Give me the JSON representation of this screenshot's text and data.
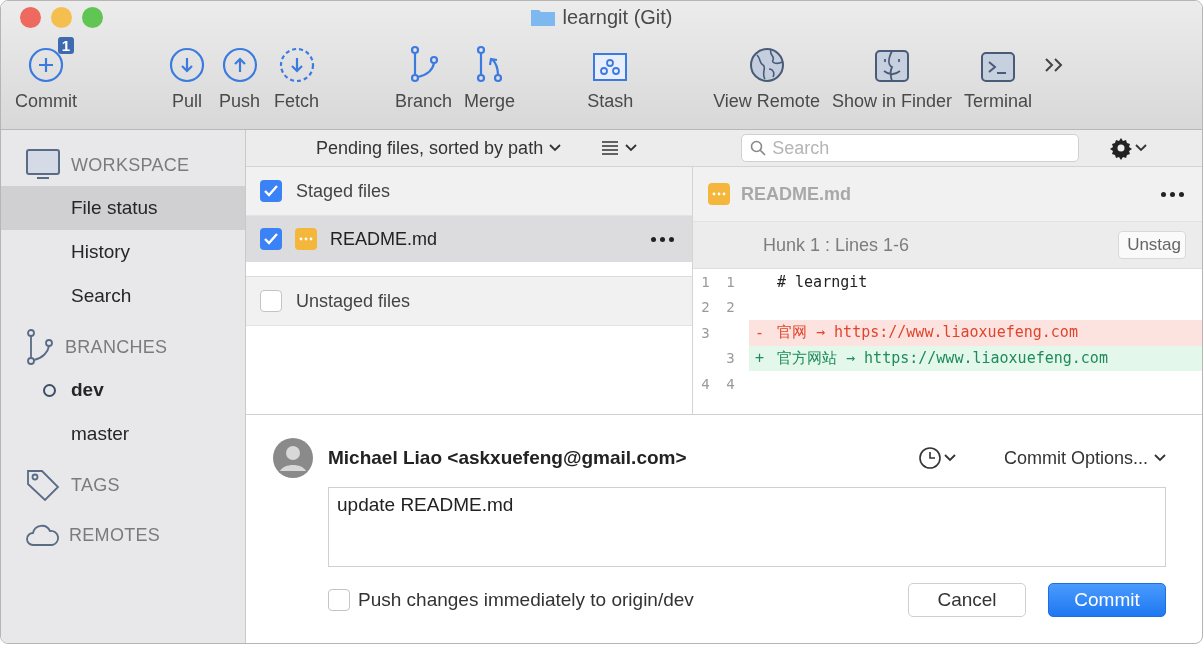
{
  "window": {
    "title": "learngit (Git)"
  },
  "toolbar": {
    "buttons": [
      {
        "label": "Commit",
        "badge": "1"
      },
      {
        "label": "Pull"
      },
      {
        "label": "Push"
      },
      {
        "label": "Fetch"
      },
      {
        "label": "Branch"
      },
      {
        "label": "Merge"
      },
      {
        "label": "Stash"
      },
      {
        "label": "View Remote"
      },
      {
        "label": "Show in Finder"
      },
      {
        "label": "Terminal"
      }
    ]
  },
  "sidebar": {
    "sections": [
      {
        "heading": "WORKSPACE",
        "items": [
          {
            "label": "File status",
            "selected": true,
            "current": false
          },
          {
            "label": "History",
            "selected": false,
            "current": false
          },
          {
            "label": "Search",
            "selected": false,
            "current": false
          }
        ]
      },
      {
        "heading": "BRANCHES",
        "items": [
          {
            "label": "dev",
            "selected": false,
            "current": true
          },
          {
            "label": "master",
            "selected": false,
            "current": false
          }
        ]
      },
      {
        "heading": "TAGS"
      },
      {
        "heading": "REMOTES"
      }
    ]
  },
  "filter_bar": {
    "sort_label": "Pending files, sorted by path",
    "search": {
      "placeholder": "Search"
    }
  },
  "staged": {
    "label": "Staged files",
    "checked": true,
    "files": [
      {
        "name": "README.md",
        "checked": true,
        "selected": true
      }
    ]
  },
  "unstaged": {
    "label": "Unstaged files",
    "checked": false
  },
  "diff": {
    "file": "README.md",
    "hunk_title": "Hunk 1 : Lines 1-6",
    "hunk_button": "Unstag",
    "lines": [
      {
        "kind": "context",
        "old": "1",
        "new": "1",
        "text": "# learngit"
      },
      {
        "kind": "context",
        "old": "2",
        "new": "2"
      },
      {
        "kind": "removed",
        "old": "3",
        "sign": "-",
        "text": "官网 → https://www.liaoxuefeng.com"
      },
      {
        "kind": "added",
        "new": "3",
        "sign": "+",
        "text": "官方网站 → https://www.liaoxuefeng.com"
      },
      {
        "kind": "context",
        "old": "4",
        "new": "4"
      }
    ]
  },
  "commit": {
    "author": "Michael Liao <askxuefeng@gmail.com>",
    "options": "Commit Options...",
    "message": "update README.md",
    "push": {
      "label": "Push changes immediately to origin/dev",
      "checked": false
    },
    "buttons": [
      {
        "label": "Cancel",
        "kind": "secondary"
      },
      {
        "label": "Commit",
        "kind": "primary"
      }
    ]
  }
}
